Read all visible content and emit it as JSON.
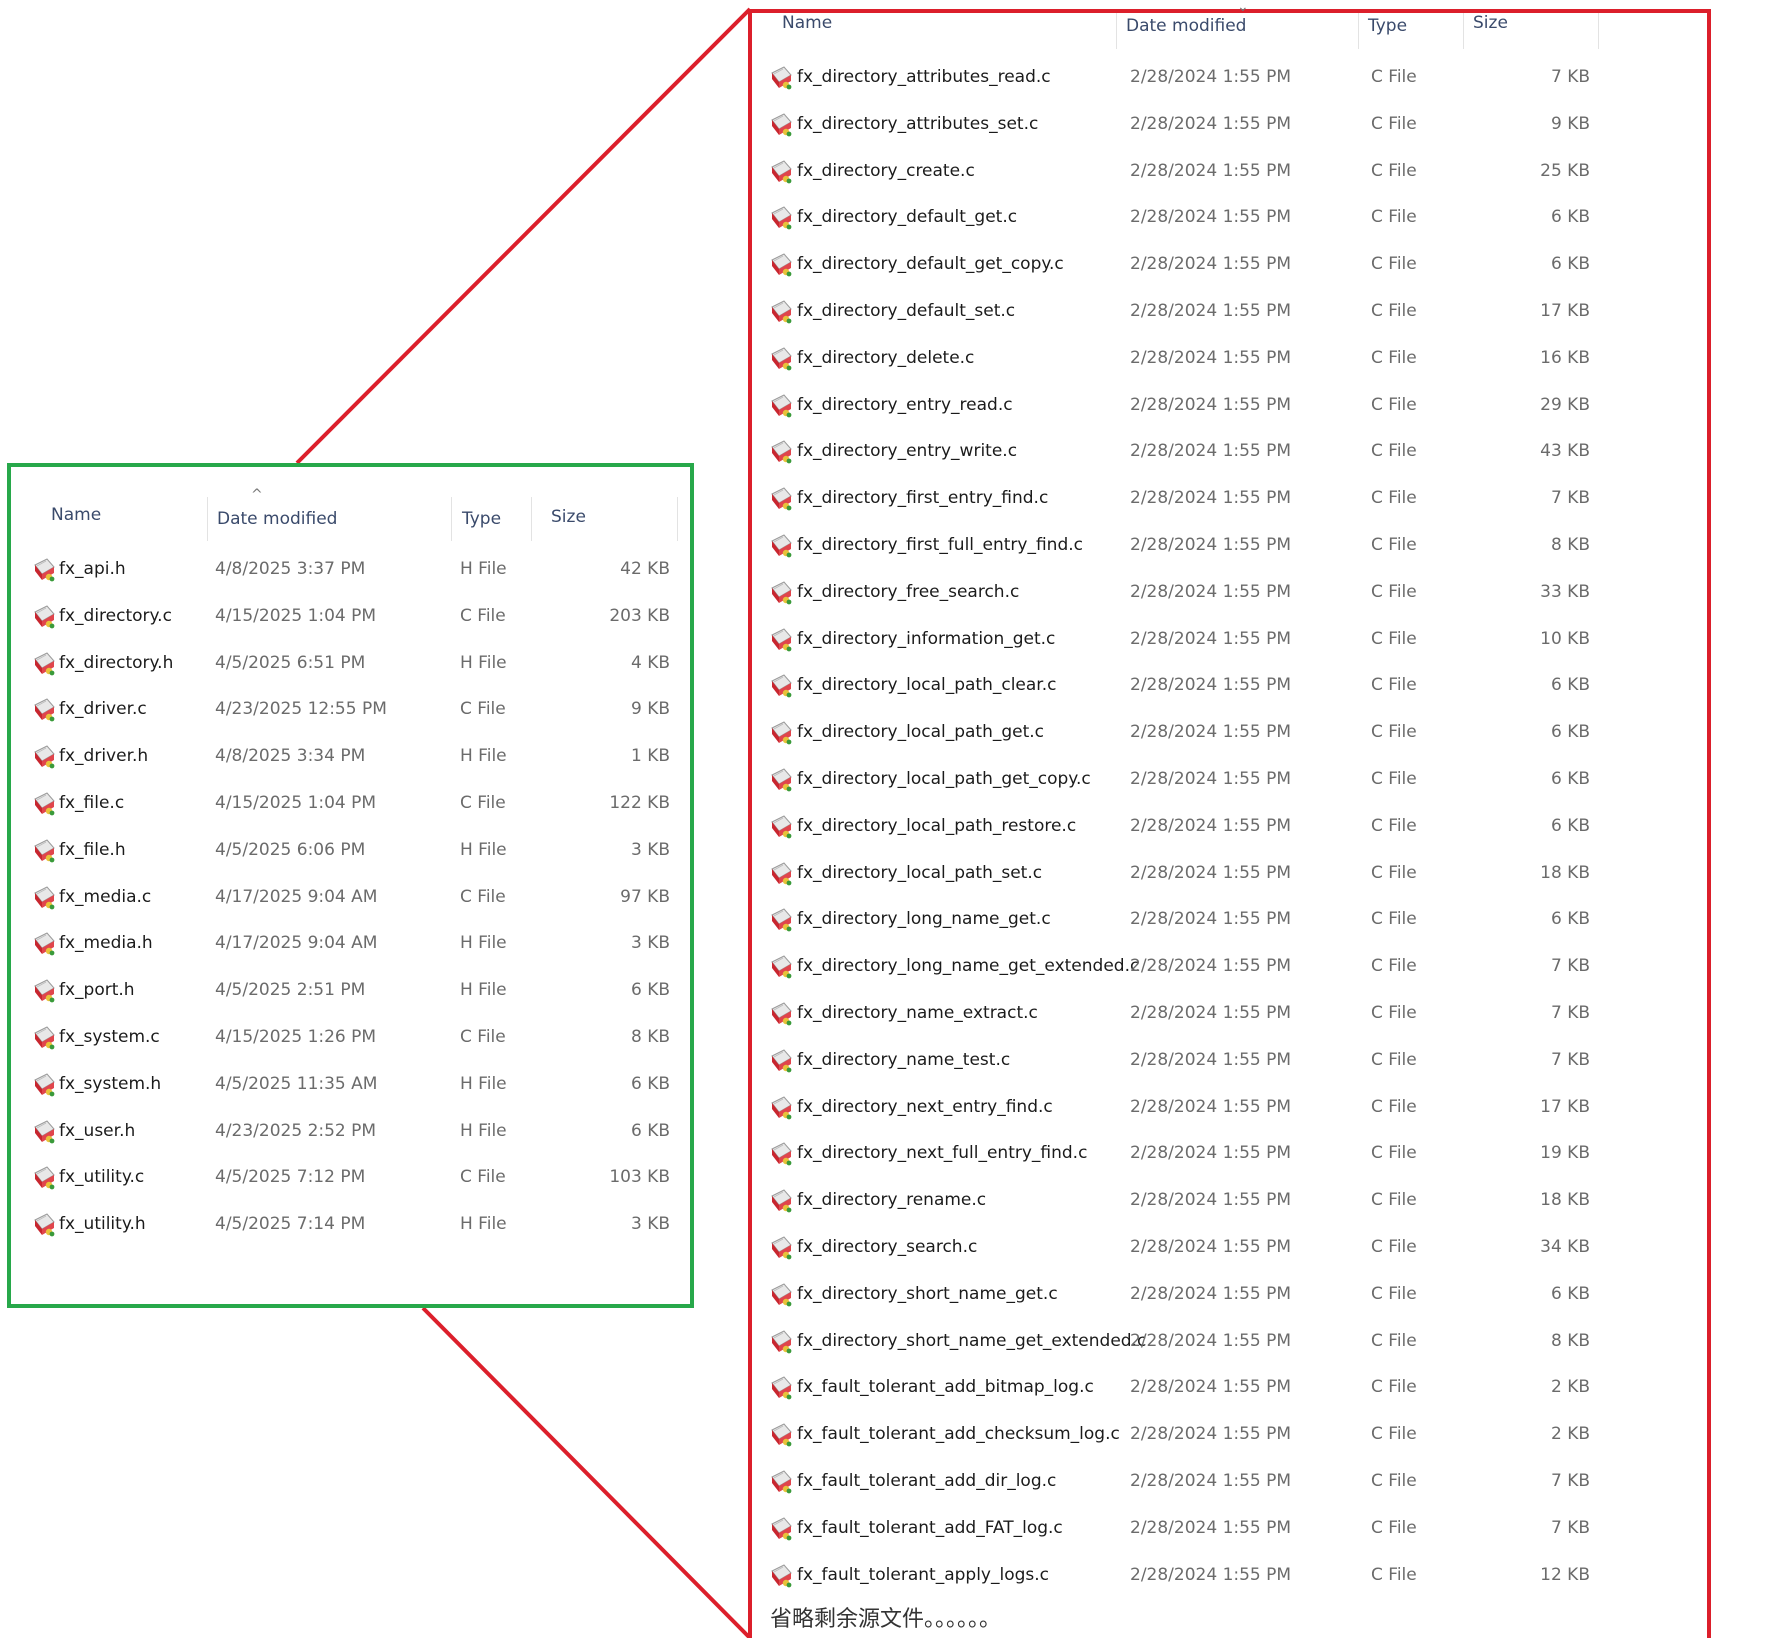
{
  "columns": {
    "name": "Name",
    "date_modified": "Date modified",
    "type": "Type",
    "size": "Size"
  },
  "left_panel": {
    "files": [
      {
        "name": "fx_api.h",
        "date": "4/8/2025 3:37 PM",
        "type": "H File",
        "size": "42 KB"
      },
      {
        "name": "fx_directory.c",
        "date": "4/15/2025 1:04 PM",
        "type": "C File",
        "size": "203 KB"
      },
      {
        "name": "fx_directory.h",
        "date": "4/5/2025 6:51 PM",
        "type": "H File",
        "size": "4 KB"
      },
      {
        "name": "fx_driver.c",
        "date": "4/23/2025 12:55 PM",
        "type": "C File",
        "size": "9 KB"
      },
      {
        "name": "fx_driver.h",
        "date": "4/8/2025 3:34 PM",
        "type": "H File",
        "size": "1 KB"
      },
      {
        "name": "fx_file.c",
        "date": "4/15/2025 1:04 PM",
        "type": "C File",
        "size": "122 KB"
      },
      {
        "name": "fx_file.h",
        "date": "4/5/2025 6:06 PM",
        "type": "H File",
        "size": "3 KB"
      },
      {
        "name": "fx_media.c",
        "date": "4/17/2025 9:04 AM",
        "type": "C File",
        "size": "97 KB"
      },
      {
        "name": "fx_media.h",
        "date": "4/17/2025 9:04 AM",
        "type": "H File",
        "size": "3 KB"
      },
      {
        "name": "fx_port.h",
        "date": "4/5/2025 2:51 PM",
        "type": "H File",
        "size": "6 KB"
      },
      {
        "name": "fx_system.c",
        "date": "4/15/2025 1:26 PM",
        "type": "C File",
        "size": "8 KB"
      },
      {
        "name": "fx_system.h",
        "date": "4/5/2025 11:35 AM",
        "type": "H File",
        "size": "6 KB"
      },
      {
        "name": "fx_user.h",
        "date": "4/23/2025 2:52 PM",
        "type": "H File",
        "size": "6 KB"
      },
      {
        "name": "fx_utility.c",
        "date": "4/5/2025 7:12 PM",
        "type": "C File",
        "size": "103 KB"
      },
      {
        "name": "fx_utility.h",
        "date": "4/5/2025 7:14 PM",
        "type": "H File",
        "size": "3 KB"
      }
    ]
  },
  "right_panel": {
    "files": [
      {
        "name": "fx_directory_attributes_read.c",
        "date": "2/28/2024 1:55 PM",
        "type": "C File",
        "size": "7 KB"
      },
      {
        "name": "fx_directory_attributes_set.c",
        "date": "2/28/2024 1:55 PM",
        "type": "C File",
        "size": "9 KB"
      },
      {
        "name": "fx_directory_create.c",
        "date": "2/28/2024 1:55 PM",
        "type": "C File",
        "size": "25 KB"
      },
      {
        "name": "fx_directory_default_get.c",
        "date": "2/28/2024 1:55 PM",
        "type": "C File",
        "size": "6 KB"
      },
      {
        "name": "fx_directory_default_get_copy.c",
        "date": "2/28/2024 1:55 PM",
        "type": "C File",
        "size": "6 KB"
      },
      {
        "name": "fx_directory_default_set.c",
        "date": "2/28/2024 1:55 PM",
        "type": "C File",
        "size": "17 KB"
      },
      {
        "name": "fx_directory_delete.c",
        "date": "2/28/2024 1:55 PM",
        "type": "C File",
        "size": "16 KB"
      },
      {
        "name": "fx_directory_entry_read.c",
        "date": "2/28/2024 1:55 PM",
        "type": "C File",
        "size": "29 KB"
      },
      {
        "name": "fx_directory_entry_write.c",
        "date": "2/28/2024 1:55 PM",
        "type": "C File",
        "size": "43 KB"
      },
      {
        "name": "fx_directory_first_entry_find.c",
        "date": "2/28/2024 1:55 PM",
        "type": "C File",
        "size": "7 KB"
      },
      {
        "name": "fx_directory_first_full_entry_find.c",
        "date": "2/28/2024 1:55 PM",
        "type": "C File",
        "size": "8 KB"
      },
      {
        "name": "fx_directory_free_search.c",
        "date": "2/28/2024 1:55 PM",
        "type": "C File",
        "size": "33 KB"
      },
      {
        "name": "fx_directory_information_get.c",
        "date": "2/28/2024 1:55 PM",
        "type": "C File",
        "size": "10 KB"
      },
      {
        "name": "fx_directory_local_path_clear.c",
        "date": "2/28/2024 1:55 PM",
        "type": "C File",
        "size": "6 KB"
      },
      {
        "name": "fx_directory_local_path_get.c",
        "date": "2/28/2024 1:55 PM",
        "type": "C File",
        "size": "6 KB"
      },
      {
        "name": "fx_directory_local_path_get_copy.c",
        "date": "2/28/2024 1:55 PM",
        "type": "C File",
        "size": "6 KB"
      },
      {
        "name": "fx_directory_local_path_restore.c",
        "date": "2/28/2024 1:55 PM",
        "type": "C File",
        "size": "6 KB"
      },
      {
        "name": "fx_directory_local_path_set.c",
        "date": "2/28/2024 1:55 PM",
        "type": "C File",
        "size": "18 KB"
      },
      {
        "name": "fx_directory_long_name_get.c",
        "date": "2/28/2024 1:55 PM",
        "type": "C File",
        "size": "6 KB"
      },
      {
        "name": "fx_directory_long_name_get_extended.c",
        "date": "2/28/2024 1:55 PM",
        "type": "C File",
        "size": "7 KB"
      },
      {
        "name": "fx_directory_name_extract.c",
        "date": "2/28/2024 1:55 PM",
        "type": "C File",
        "size": "7 KB"
      },
      {
        "name": "fx_directory_name_test.c",
        "date": "2/28/2024 1:55 PM",
        "type": "C File",
        "size": "7 KB"
      },
      {
        "name": "fx_directory_next_entry_find.c",
        "date": "2/28/2024 1:55 PM",
        "type": "C File",
        "size": "17 KB"
      },
      {
        "name": "fx_directory_next_full_entry_find.c",
        "date": "2/28/2024 1:55 PM",
        "type": "C File",
        "size": "19 KB"
      },
      {
        "name": "fx_directory_rename.c",
        "date": "2/28/2024 1:55 PM",
        "type": "C File",
        "size": "18 KB"
      },
      {
        "name": "fx_directory_search.c",
        "date": "2/28/2024 1:55 PM",
        "type": "C File",
        "size": "34 KB"
      },
      {
        "name": "fx_directory_short_name_get.c",
        "date": "2/28/2024 1:55 PM",
        "type": "C File",
        "size": "6 KB"
      },
      {
        "name": "fx_directory_short_name_get_extended.c",
        "date": "2/28/2024 1:55 PM",
        "type": "C File",
        "size": "8 KB"
      },
      {
        "name": "fx_fault_tolerant_add_bitmap_log.c",
        "date": "2/28/2024 1:55 PM",
        "type": "C File",
        "size": "2 KB"
      },
      {
        "name": "fx_fault_tolerant_add_checksum_log.c",
        "date": "2/28/2024 1:55 PM",
        "type": "C File",
        "size": "2 KB"
      },
      {
        "name": "fx_fault_tolerant_add_dir_log.c",
        "date": "2/28/2024 1:55 PM",
        "type": "C File",
        "size": "7 KB"
      },
      {
        "name": "fx_fault_tolerant_add_FAT_log.c",
        "date": "2/28/2024 1:55 PM",
        "type": "C File",
        "size": "7 KB"
      },
      {
        "name": "fx_fault_tolerant_apply_logs.c",
        "date": "2/28/2024 1:55 PM",
        "type": "C File",
        "size": "12 KB"
      }
    ],
    "footer_note": "省略剩余源文件。。。。。。"
  },
  "colors": {
    "left_frame": "#27a84a",
    "right_frame": "#dc1f2b",
    "header_text": "#3a4a6b",
    "muted_text": "#6b6b6b"
  },
  "icons": {
    "file": "source-file-icon",
    "sort": "sort-caret-icon"
  }
}
